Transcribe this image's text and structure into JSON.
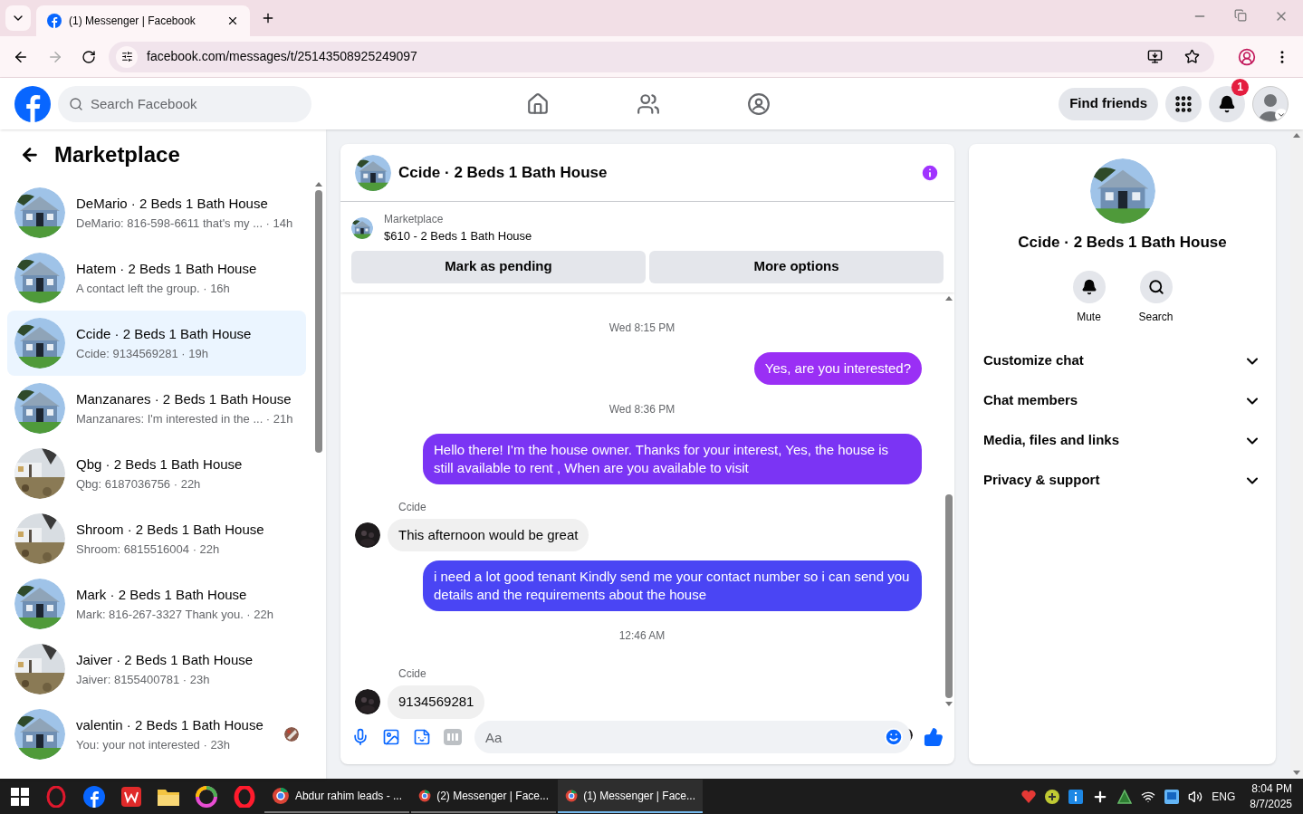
{
  "browser": {
    "tabs": [
      {
        "title": "(1) Messenger | Facebook",
        "selected": true
      }
    ],
    "url": "facebook.com/messages/t/25143508925249097"
  },
  "header": {
    "search_placeholder": "Search Facebook",
    "find_friends": "Find friends",
    "notification_count": "1"
  },
  "sidebar": {
    "title": "Marketplace",
    "conversations": [
      {
        "title": "DeMario · 2 Beds 1 Bath House",
        "preview": "DeMario: 816-598-6611 that's my ... · 14h",
        "selected": false
      },
      {
        "title": "Hatem · 2 Beds 1 Bath House",
        "preview": "A contact left the group. · 16h",
        "selected": false
      },
      {
        "title": "Ccide · 2 Beds 1 Bath House",
        "preview": "Ccide: 9134569281 · 19h",
        "selected": true
      },
      {
        "title": "Manzanares · 2 Beds 1 Bath House",
        "preview": "Manzanares: I'm interested in the ... · 21h",
        "selected": false
      },
      {
        "title": "Qbg · 2 Beds 1 Bath House",
        "preview": "Qbg: 6187036756 · 22h",
        "selected": false
      },
      {
        "title": "Shroom · 2 Beds 1 Bath House",
        "preview": "Shroom: 6815516004 · 22h",
        "selected": false
      },
      {
        "title": "Mark · 2 Beds 1 Bath House",
        "preview": "Mark: 816-267-3327 Thank you. · 22h",
        "selected": false
      },
      {
        "title": "Jaiver · 2 Beds 1 Bath House",
        "preview": "Jaiver: 8155400781 · 23h",
        "selected": false
      },
      {
        "title": "valentin · 2 Beds 1 Bath House",
        "preview": "You: your not interested · 23h",
        "selected": false,
        "seen": true
      }
    ]
  },
  "chat": {
    "title": "Ccide · 2 Beds 1 Bath House",
    "listing": {
      "label": "Marketplace",
      "text": "$610 - 2 Beds 1 Bath House"
    },
    "actions": [
      "Mark as pending",
      "More options"
    ],
    "messages": [
      {
        "kind": "time",
        "text": "Wed 8:15 PM"
      },
      {
        "kind": "sent",
        "text": "Yes, are you interested?",
        "color": "#9a2ff5"
      },
      {
        "kind": "time",
        "text": "Wed 8:36 PM"
      },
      {
        "kind": "sent",
        "text": "Hello there! I'm the house owner. Thanks for your interest, Yes, the house is still available to rent , When are you available to visit",
        "color": "#7b34f4"
      },
      {
        "kind": "received",
        "sender": "Ccide",
        "text": "This afternoon would be great"
      },
      {
        "kind": "sent",
        "text": "i need a lot good tenant Kindly send me your contact number so i can send you details and the requirements about the house",
        "color": "#4a45f4"
      },
      {
        "kind": "time",
        "text": "12:46 AM"
      },
      {
        "kind": "received",
        "sender": "Ccide",
        "text": "9134569281"
      }
    ],
    "composer_placeholder": "Aa"
  },
  "details": {
    "title": "Ccide · 2 Beds 1 Bath House",
    "actions": [
      "Mute",
      "Search"
    ],
    "sections": [
      "Customize chat",
      "Chat members",
      "Media, files and links",
      "Privacy & support"
    ]
  },
  "taskbar": {
    "windows": [
      "Abdur rahim leads - ...",
      "(2) Messenger | Face...",
      "(1) Messenger | Face..."
    ],
    "language": "ENG",
    "time": "8:04 PM",
    "date": "8/7/2025"
  }
}
